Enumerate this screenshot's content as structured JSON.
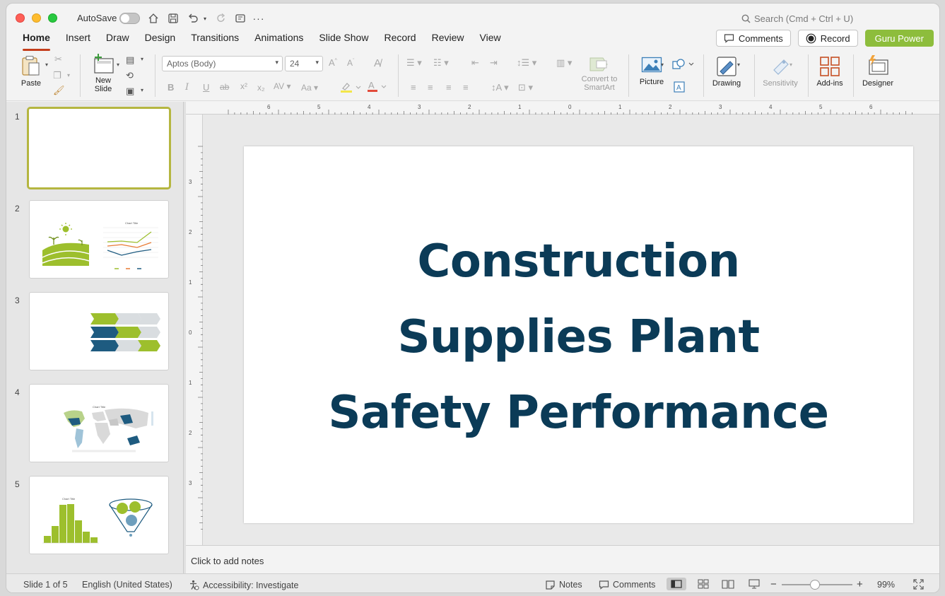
{
  "titlebar": {
    "autosave_label": "AutoSave",
    "search_placeholder": "Search (Cmd + Ctrl + U)"
  },
  "tabs": [
    "Home",
    "Insert",
    "Draw",
    "Design",
    "Transitions",
    "Animations",
    "Slide Show",
    "Record",
    "Review",
    "View"
  ],
  "active_tab": "Home",
  "top_buttons": {
    "comments": "Comments",
    "record": "Record",
    "guru": "Guru Power"
  },
  "ribbon": {
    "paste": "Paste",
    "new_slide_line1": "New",
    "new_slide_line2": "Slide",
    "font_name": "Aptos (Body)",
    "font_size": "24",
    "convert_line1": "Convert to",
    "convert_line2": "SmartArt",
    "picture": "Picture",
    "drawing": "Drawing",
    "sensitivity": "Sensitivity",
    "addins": "Add-ins",
    "designer": "Designer"
  },
  "ruler": {
    "horizontal": [
      "6",
      "5",
      "4",
      "3",
      "2",
      "1",
      "0",
      "1",
      "2",
      "3",
      "4",
      "5",
      "6"
    ],
    "vertical": [
      "3",
      "2",
      "1",
      "0",
      "1",
      "2",
      "3"
    ]
  },
  "slides": [
    {
      "number": "1"
    },
    {
      "number": "2",
      "chart_title": "Chart Title"
    },
    {
      "number": "3"
    },
    {
      "number": "4",
      "chart_title": "Chart Title"
    },
    {
      "number": "5",
      "chart_title": "Chart Title"
    }
  ],
  "main_slide": {
    "title_lines": [
      "Construction",
      "Supplies Plant",
      "Safety Performance"
    ],
    "title_color": "#0b3b57"
  },
  "notes_placeholder": "Click to add notes",
  "status": {
    "slide_counter": "Slide 1 of 5",
    "language": "English (United States)",
    "accessibility": "Accessibility: Investigate",
    "notes": "Notes",
    "comments": "Comments",
    "zoom": "99%"
  },
  "colors": {
    "accent_red": "#c43e1c",
    "guru_green": "#8dbd3c",
    "slide_green": "#9dbf2d",
    "slide_blue": "#1e5b80"
  }
}
